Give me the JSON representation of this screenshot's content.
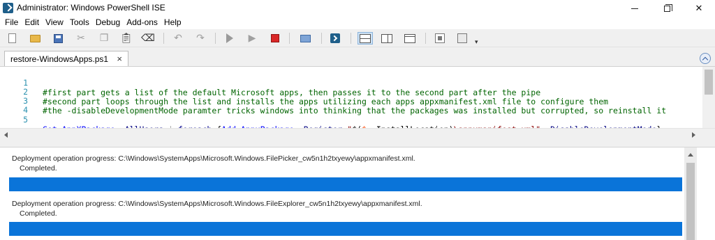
{
  "window": {
    "title": "Administrator: Windows PowerShell ISE"
  },
  "menu": {
    "items": [
      "File",
      "Edit",
      "View",
      "Tools",
      "Debug",
      "Add-ons",
      "Help"
    ]
  },
  "tab": {
    "label": "restore-WindowsApps.ps1",
    "close_glyph": "×"
  },
  "editor": {
    "line_numbers": [
      "1",
      "2",
      "3",
      "4",
      "5"
    ],
    "lines": [
      "#first part gets a list of the default Microsoft apps, then passes it to the second part after the pipe",
      "#second part loops through the list and installs the apps utilizing each apps appxmanifest.xml file to configure them",
      "#the -disableDevelopmentMode paramter tricks windows into thinking that the packages was installed but corrupted, so reinstall it",
      "",
      "Get-AppXPackage -AllUsers | foreach {Add-AppxPackage -Register \"$($_.InstallLocation)\\appxmanifest.xml\" -DisableDevelopmentMode}"
    ],
    "tokens_line5": {
      "cmd1": "Get-AppXPackage",
      "param1": " -AllUsers",
      "pipe": " | ",
      "foreach": "foreach",
      "open": " {",
      "cmd2": "Add-AppxPackage",
      "param2": " -Register",
      "str1": " \"",
      "sub": "$(",
      "var": "$_",
      "prop": ".InstallLocation)",
      "str2": "\\appxmanifest.xml\"",
      "param3": " -DisableDevelopmentMode",
      "close": "}"
    }
  },
  "console": {
    "entries": [
      {
        "label": "Deployment operation progress: C:\\Windows\\SystemApps\\Microsoft.Windows.FilePicker_cw5n1h2txyewy\\appxmanifest.xml.",
        "status": "Completed.",
        "progress": 1.0
      },
      {
        "label": "Deployment operation progress: C:\\Windows\\SystemApps\\Microsoft.Windows.FileExplorer_cw5n1h2txyewy\\appxmanifest.xml.",
        "status": "Completed.",
        "progress": 1.0
      }
    ],
    "progress_color": "#0a74d9"
  },
  "icons": {
    "titlebar": "powershell-ise-icon",
    "toolbar": [
      "new-file-icon",
      "open-icon",
      "save-icon",
      "cut-icon",
      "copy-icon",
      "paste-icon",
      "clear-icon",
      "undo-icon",
      "redo-icon",
      "run-icon",
      "stop-icon",
      "new-remote-tab-icon",
      "powershell-icon",
      "layout-top-icon",
      "layout-right-icon",
      "layout-max-icon",
      "snippets-icon",
      "addon-icon"
    ]
  }
}
